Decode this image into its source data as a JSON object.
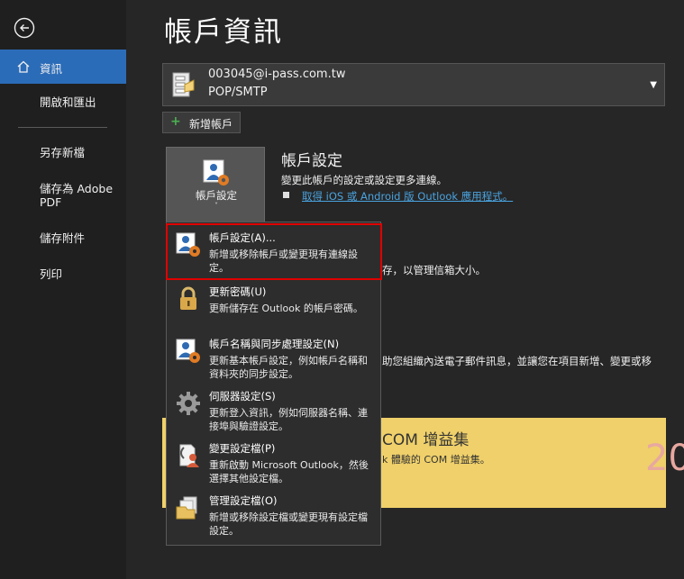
{
  "sidebar": {
    "back_icon": "back-arrow-icon",
    "active_icon": "home-icon",
    "active": "資訊",
    "items": [
      "開啟和匯出",
      "另存新檔",
      "儲存為 Adobe PDF",
      "儲存附件",
      "列印"
    ]
  },
  "page": {
    "title": "帳戶資訊"
  },
  "account": {
    "email": "003045@i-pass.com.tw",
    "type": "POP/SMTP"
  },
  "add_account": {
    "label": "新增帳戶"
  },
  "settings_button": {
    "label": "帳戶設定",
    "caret": "˅"
  },
  "section": {
    "title": "帳戶設定",
    "description": "變更此帳戶的設定或設定更多連線。",
    "link": "取得 iOS 或 Android 版 Outlook 應用程式。"
  },
  "background": {
    "text1": "存，以管理信箱大小。",
    "text2": "助您組織內送電子郵件訊息，並讓您在項目新增、變更或移"
  },
  "com_banner": {
    "title": "COM 增益集",
    "desc": "k 體驗的 COM 增益集。",
    "watermark": "20"
  },
  "menu": [
    {
      "title": "帳戶設定(A)...",
      "desc": "新增或移除帳戶或變更現有連線設定。",
      "icon": "account-settings-icon"
    },
    {
      "title": "更新密碼(U)",
      "desc": "更新儲存在 Outlook 的帳戶密碼。",
      "icon": "lock-icon"
    },
    {
      "title": "帳戶名稱與同步處理設定(N)",
      "desc": "更新基本帳戶設定，例如帳戶名稱和資料夾的同步設定。",
      "icon": "account-sync-icon"
    },
    {
      "title": "伺服器設定(S)",
      "desc": "更新登入資訊，例如伺服器名稱、連接埠與驗證設定。",
      "icon": "gear-icon"
    },
    {
      "title": "變更設定檔(P)",
      "desc": "重新啟動 Microsoft Outlook，然後選擇其他設定檔。",
      "icon": "change-profile-icon"
    },
    {
      "title": "管理設定檔(O)",
      "desc": "新增或移除設定檔或變更現有設定檔設定。",
      "icon": "manage-profiles-icon"
    }
  ],
  "colors": {
    "accent": "#2b6cb8",
    "highlight_border": "#e00000",
    "banner": "#efd06a",
    "link": "#4aa3df"
  }
}
